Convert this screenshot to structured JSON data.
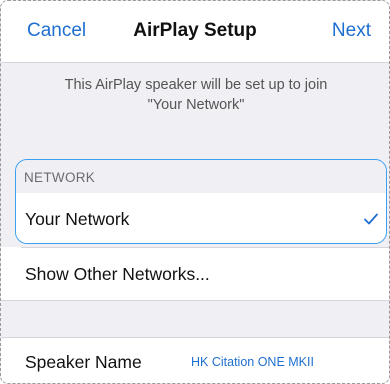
{
  "navbar": {
    "cancel_label": "Cancel",
    "title": "AirPlay Setup",
    "next_label": "Next"
  },
  "info": {
    "line1": "This AirPlay speaker will be set up to join",
    "line2": "\"Your Network\""
  },
  "network_section": {
    "header": "NETWORK",
    "selected_network": "Your Network",
    "check_icon": "checkmark-icon"
  },
  "other_networks": {
    "label": "Show Other Networks..."
  },
  "speaker": {
    "label": "Speaker Name",
    "value": "HK Citation ONE MKII"
  },
  "colors": {
    "accent": "#1f6fd0",
    "highlight_border": "#3aa0f0",
    "background": "#efeff4"
  }
}
